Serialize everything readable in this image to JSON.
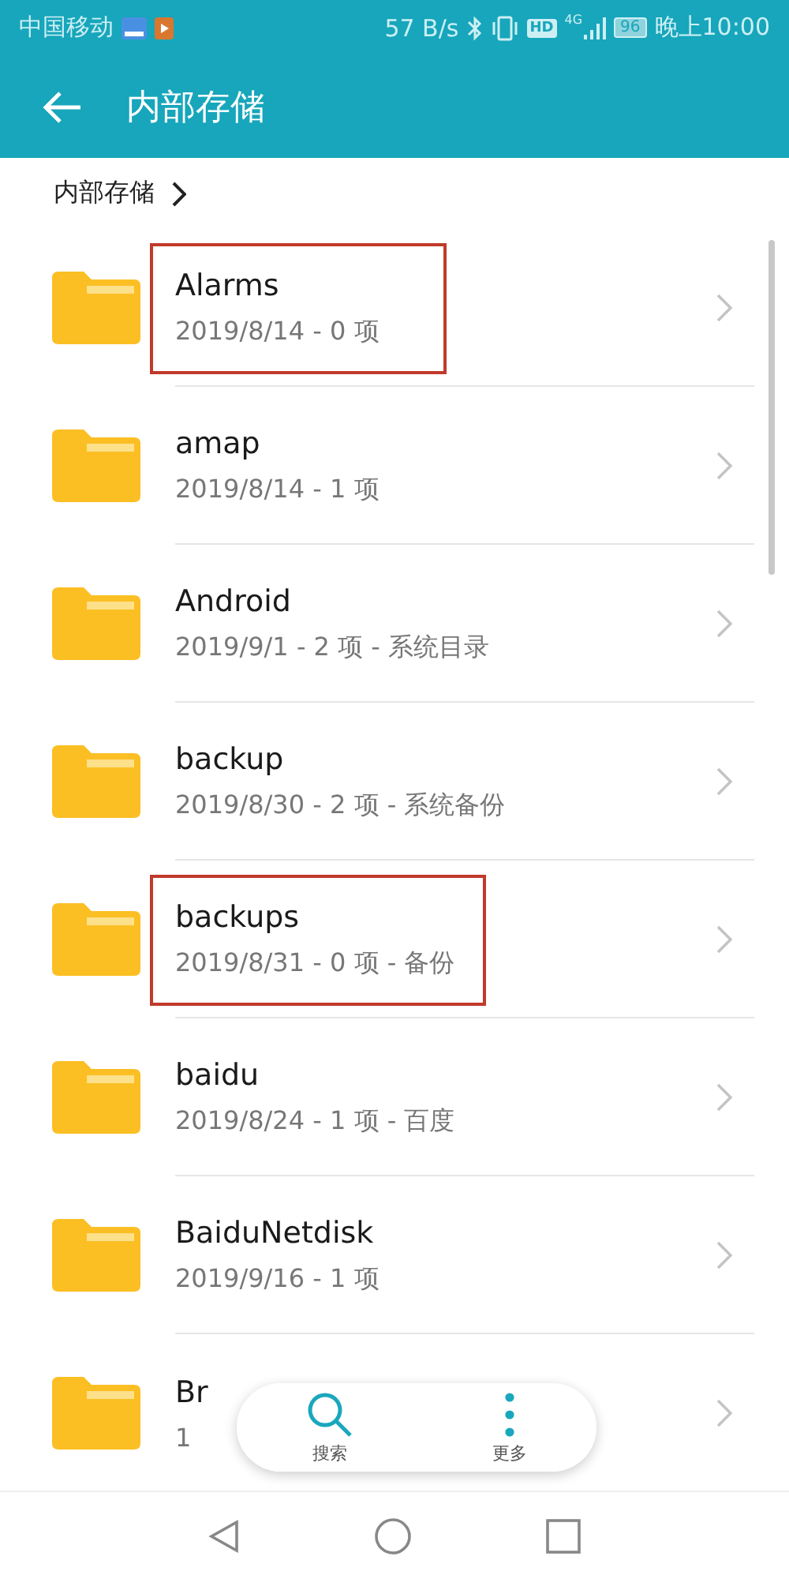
{
  "status_bar": {
    "carrier": "中国移动",
    "speed": "57 B/s",
    "hd": "HD",
    "network": "4G",
    "battery": "96",
    "time": "晚上10:00"
  },
  "app_bar": {
    "title": "内部存储"
  },
  "breadcrumb": {
    "label": "内部存储"
  },
  "folders": [
    {
      "name": "Alarms",
      "info": "2019/8/14 - 0 项",
      "highlighted": true
    },
    {
      "name": "amap",
      "info": "2019/8/14 - 1 项",
      "highlighted": false
    },
    {
      "name": "Android",
      "info": "2019/9/1 - 2 项 - 系统目录",
      "highlighted": false
    },
    {
      "name": "backup",
      "info": "2019/8/30 - 2 项 - 系统备份",
      "highlighted": false
    },
    {
      "name": "backups",
      "info": "2019/8/31 - 0 项 - 备份",
      "highlighted": true
    },
    {
      "name": "baidu",
      "info": "2019/8/24 - 1 项 - 百度",
      "highlighted": false
    },
    {
      "name": "BaiduNetdisk",
      "info": "2019/9/16 - 1 项",
      "highlighted": false
    },
    {
      "name": "Br",
      "info": "1",
      "highlighted": false
    }
  ],
  "bottom_actions": [
    {
      "kind": "search",
      "label": "搜索"
    },
    {
      "kind": "more",
      "label": "更多"
    }
  ]
}
